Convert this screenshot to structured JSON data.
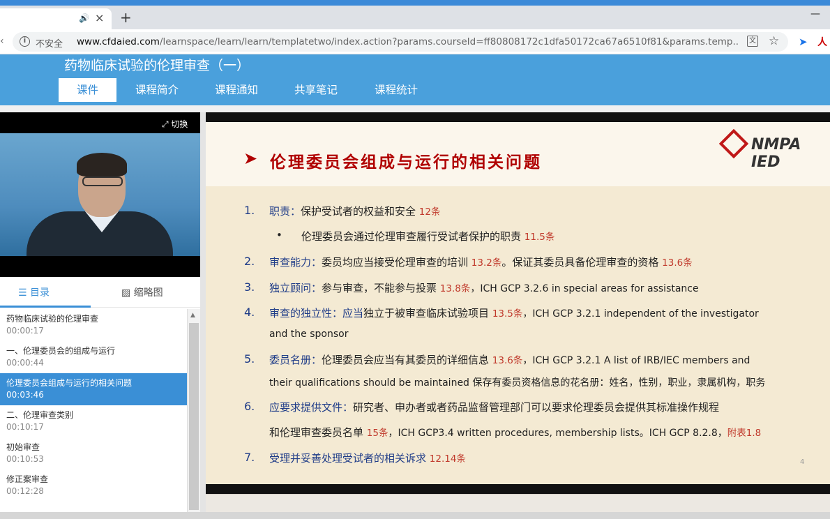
{
  "browser": {
    "tab_close": "×",
    "new_tab": "+",
    "minimize": "—",
    "security_label": "不安全",
    "url_host": "www.cfdaied.com",
    "url_path": "/learnspace/learn/learn/templatetwo/index.action?params.courseId=ff80808172c1dfa50172ca67a6510f81&params.temp..."
  },
  "site": {
    "course_title": "药物临床试验的伦理审查（一）",
    "tabs": [
      "课件",
      "课程简介",
      "课程通知",
      "共享笔记",
      "课程统计"
    ],
    "active_tab": 0
  },
  "video": {
    "switch_label": "切换"
  },
  "toc": {
    "tab_catalog": "目录",
    "tab_thumbnails": "缩略图",
    "items": [
      {
        "title": "药物临床试验的伦理审查",
        "time": "00:00:17"
      },
      {
        "title": "一、伦理委员会的组成与运行",
        "time": "00:00:44"
      },
      {
        "title": "伦理委员会组成与运行的相关问题",
        "time": "00:03:46"
      },
      {
        "title": "二、伦理审查类别",
        "time": "00:10:17"
      },
      {
        "title": "初始审查",
        "time": "00:10:53"
      },
      {
        "title": "修正案审查",
        "time": "00:12:28"
      }
    ],
    "active_index": 2
  },
  "slide": {
    "title": "伦理委员会组成与运行的相关问题",
    "logo": "NMPA IED",
    "page_number": "4",
    "items": [
      {
        "num": "1.",
        "label": "职责：",
        "text": "保护受试者的权益和安全 ",
        "ref": "12条"
      },
      {
        "bullet": "•",
        "text": "伦理委员会通过伦理审查履行受试者保护的职责 ",
        "ref": "11.5条"
      },
      {
        "num": "2.",
        "label": "审查能力：",
        "text": "委员均应当接受伦理审查的培训 ",
        "ref": "13.2条",
        "text2": "。保证其委员具备伦理审查的资格 ",
        "ref2": "13.6条"
      },
      {
        "num": "3.",
        "label": "独立顾问：",
        "text": "参与审查，不能参与投票 ",
        "ref": "13.8条",
        "text2": "，ICH GCP 3.2.6 in special areas for assistance"
      },
      {
        "num": "4.",
        "label": "审查的独立性：",
        "label2": "应当",
        "text": "独立于被审查临床试验项目 ",
        "ref": "13.5条",
        "text2": "，ICH GCP 3.2.1 independent of the investigator",
        "cont": "and the sponsor"
      },
      {
        "num": "5.",
        "label": "委员名册：",
        "text": "伦理委员会应当有其委员的详细信息 ",
        "ref": "13.6条",
        "text2": "，ICH GCP 3.2.1 A list of IRB/IEC members and",
        "cont": "their qualifications should be maintained 保存有委员资格信息的花名册：姓名，性别，职业，隶属机构，职务"
      },
      {
        "num": "6.",
        "label": "应要求提供文件：",
        "text": "研究者、申办者或者药品监督管理部门可以要求伦理委员会提供其标准操作规程",
        "cont": "和伦理审查委员名单 ",
        "ref": "15条",
        "text2": "，ICH GCP3.4 written procedures, membership lists。ICH GCP 8.2.8，",
        "ref2": "附表1.8"
      },
      {
        "num": "7.",
        "label": "受理并妥善处理受试者的相关诉求 ",
        "ref": "12.14条"
      }
    ]
  },
  "colors": {
    "header_blue": "#4aa0dc",
    "active_blue": "#3a8fd6",
    "slide_red": "#b00000",
    "label_blue": "#1f3c88",
    "ref_red": "#c0392b"
  },
  "icons": {
    "speaker": "speaker-icon",
    "info": "info-icon",
    "translate": "translate-icon",
    "star": "star-icon",
    "expand": "expand-icon",
    "list": "list-icon",
    "image": "image-icon"
  }
}
